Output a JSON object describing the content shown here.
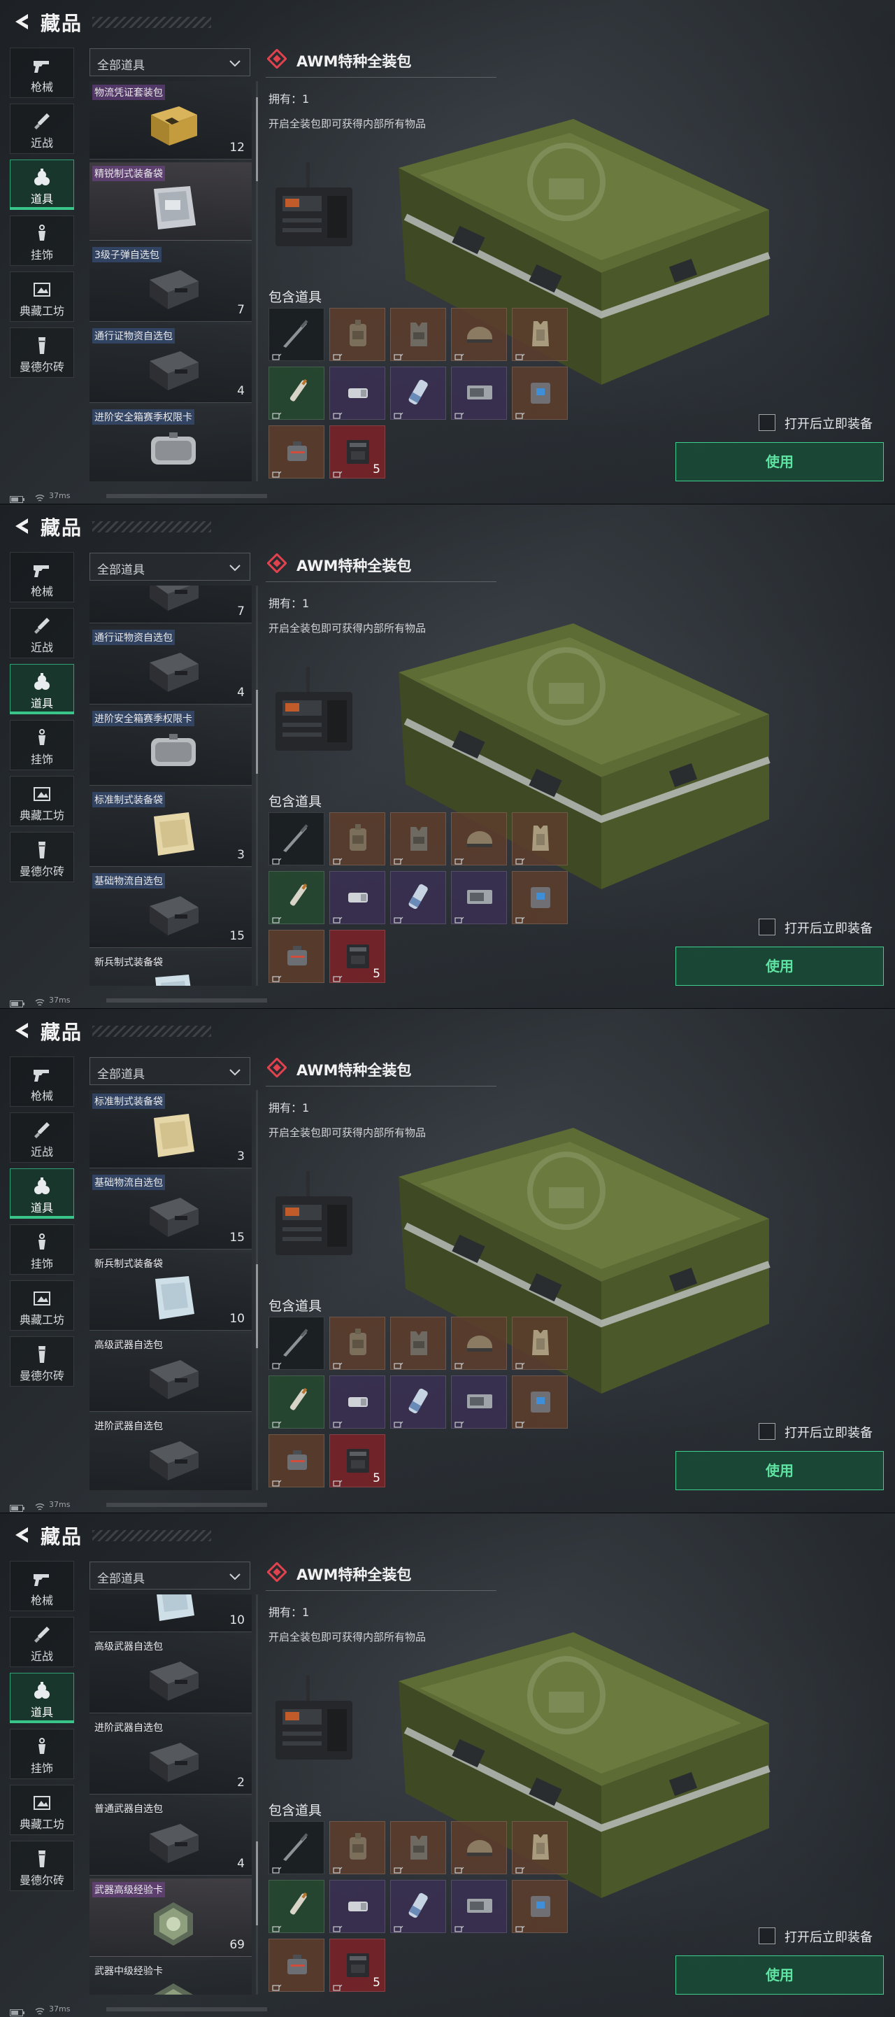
{
  "header": {
    "title": "藏品"
  },
  "categories": [
    {
      "label": "枪械",
      "icon": "pistol-icon"
    },
    {
      "label": "近战",
      "icon": "knife-icon"
    },
    {
      "label": "道具",
      "icon": "grenade-icon",
      "active": true
    },
    {
      "label": "挂饰",
      "icon": "pendant-icon"
    },
    {
      "label": "典藏工坊",
      "icon": "workshop-icon"
    },
    {
      "label": "曼德尔砖",
      "icon": "brick-icon"
    }
  ],
  "filter": {
    "label": "全部道具",
    "icon": "chevron-down-icon"
  },
  "detail": {
    "title": "AWM特种全装包",
    "owned": "拥有：1",
    "description": "开启全装包即可获得内部所有物品",
    "contents_title": "包含道具",
    "contents": [
      {
        "bg": "dark",
        "icon": "rifle-icon",
        "qty": ""
      },
      {
        "bg": "brown",
        "icon": "backpack-icon",
        "qty": ""
      },
      {
        "bg": "brown",
        "icon": "vest-icon",
        "qty": ""
      },
      {
        "bg": "brown",
        "icon": "helmet-icon",
        "qty": ""
      },
      {
        "bg": "brown",
        "icon": "armor-icon",
        "qty": ""
      },
      {
        "bg": "green",
        "icon": "syringe-icon",
        "qty": ""
      },
      {
        "bg": "purple",
        "icon": "charger-icon",
        "qty": ""
      },
      {
        "bg": "purple",
        "icon": "bandage-icon",
        "qty": ""
      },
      {
        "bg": "purple",
        "icon": "battery-icon",
        "qty": ""
      },
      {
        "bg": "brown",
        "icon": "medkit-icon",
        "qty": ""
      },
      {
        "bg": "brown",
        "icon": "toolbox-icon",
        "qty": ""
      },
      {
        "bg": "red",
        "icon": "ammo-box-icon",
        "qty": "5"
      }
    ],
    "equip_label": "打开后立即装备",
    "use_label": "使用"
  },
  "status": {
    "ping": "37ms"
  },
  "frames": [
    {
      "scroll": 0.05,
      "items": [
        {
          "name": "物流凭证套装包",
          "qty": "12",
          "quality": "purple",
          "art": "gold-box"
        },
        {
          "name": "精锐制式装备袋",
          "qty": "",
          "quality": "purple",
          "art": "silver-bag",
          "highlight": true
        },
        {
          "name": "3级子弹自选包",
          "qty": "7",
          "quality": "blue",
          "art": "dark-pack"
        },
        {
          "name": "通行证物资自选包",
          "qty": "4",
          "quality": "blue",
          "art": "dark-pack"
        },
        {
          "name": "进阶安全箱赛季权限卡",
          "qty": "",
          "quality": "blue",
          "art": "case"
        }
      ]
    },
    {
      "scroll": 0.33,
      "items": [
        {
          "name": "",
          "qty": "7",
          "quality": "none",
          "art": "dark-pack"
        },
        {
          "name": "通行证物资自选包",
          "qty": "4",
          "quality": "blue",
          "art": "dark-pack"
        },
        {
          "name": "进阶安全箱赛季权限卡",
          "qty": "",
          "quality": "blue",
          "art": "case"
        },
        {
          "name": "标准制式装备袋",
          "qty": "3",
          "quality": "blue",
          "art": "cream-bag"
        },
        {
          "name": "基础物流自选包",
          "qty": "15",
          "quality": "blue",
          "art": "dark-pack"
        },
        {
          "name": "新兵制式装备袋",
          "qty": "",
          "quality": "none",
          "art": "white-bag"
        }
      ]
    },
    {
      "scroll": 0.55,
      "items": [
        {
          "name": "标准制式装备袋",
          "qty": "3",
          "quality": "blue",
          "art": "cream-bag"
        },
        {
          "name": "基础物流自选包",
          "qty": "15",
          "quality": "blue",
          "art": "dark-pack"
        },
        {
          "name": "新兵制式装备袋",
          "qty": "10",
          "quality": "none",
          "art": "white-bag"
        },
        {
          "name": "高级武器自选包",
          "qty": "",
          "quality": "none",
          "art": "dark-pack"
        },
        {
          "name": "进阶武器自选包",
          "qty": "",
          "quality": "none",
          "art": "dark-pack"
        }
      ]
    },
    {
      "scroll": 0.78,
      "items": [
        {
          "name": "",
          "qty": "10",
          "quality": "none",
          "art": "white-bag"
        },
        {
          "name": "高级武器自选包",
          "qty": "",
          "quality": "none",
          "art": "dark-pack"
        },
        {
          "name": "进阶武器自选包",
          "qty": "2",
          "quality": "none",
          "art": "dark-pack"
        },
        {
          "name": "普通武器自选包",
          "qty": "4",
          "quality": "none",
          "art": "dark-pack"
        },
        {
          "name": "武器高级经验卡",
          "qty": "69",
          "quality": "purple",
          "art": "xp-card",
          "highlight": true
        },
        {
          "name": "武器中级经验卡",
          "qty": "",
          "quality": "none",
          "art": "xp-card"
        }
      ]
    }
  ]
}
